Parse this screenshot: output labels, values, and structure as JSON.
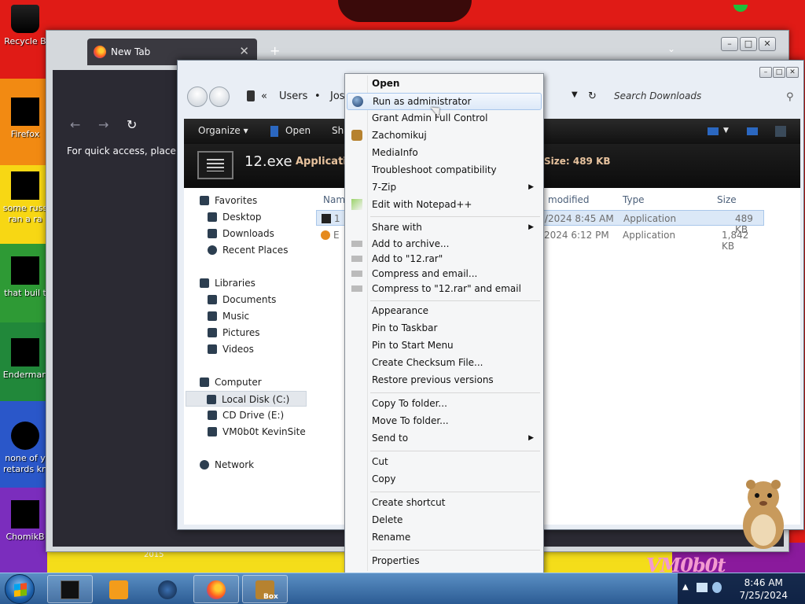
{
  "desktop": {
    "icons": [
      {
        "label": "Recycle B"
      },
      {
        "label": "Firefox"
      },
      {
        "label": "some russ"
      },
      {
        "label": "ran a ra"
      },
      {
        "label": "that buil t"
      },
      {
        "label": "Enderman"
      },
      {
        "label": "none of y"
      },
      {
        "label": "retards kn"
      },
      {
        "label": "ChomikB"
      }
    ],
    "wallpaper_text": "VM0b0t",
    "wallpaper_year": "2015"
  },
  "browser": {
    "tab_title": "New Tab",
    "new_tab_symbol": "+",
    "quick_access_text": "For quick access, place your"
  },
  "explorer": {
    "breadcrumb": [
      "«",
      "Users",
      "•",
      "Jos"
    ],
    "search_placeholder": "Search Downloads",
    "toolbar": {
      "organize": "Organize ▾",
      "open": "Open",
      "share": "Sha"
    },
    "details": {
      "name": "12.exe",
      "type": "Application",
      "size": "Size: 489 KB"
    },
    "nav": {
      "favorites": "Favorites",
      "desktop": "Desktop",
      "downloads": "Downloads",
      "recent": "Recent Places",
      "libraries": "Libraries",
      "documents": "Documents",
      "music": "Music",
      "pictures": "Pictures",
      "videos": "Videos",
      "computer": "Computer",
      "local_disk": "Local Disk (C:)",
      "cd_drive": "CD Drive (E:)",
      "vm": "VM0b0t KevinSite",
      "network": "Network"
    },
    "columns": {
      "name": "Name",
      "modified": "modified",
      "type": "Type",
      "size": "Size"
    },
    "files": [
      {
        "name": "1",
        "modified": "/2024 8:45 AM",
        "type": "Application",
        "size": "489 KB"
      },
      {
        "name": "E",
        "modified": "2024 6:12 PM",
        "type": "Application",
        "size": "1,842 KB"
      }
    ]
  },
  "context_menu": {
    "items": [
      {
        "label": "Open"
      },
      {
        "label": "Run as administrator"
      },
      {
        "label": "Grant Admin Full Control"
      },
      {
        "label": "Zachomikuj"
      },
      {
        "label": "MediaInfo"
      },
      {
        "label": "Troubleshoot compatibility"
      },
      {
        "label": "7-Zip"
      },
      {
        "label": "Edit with Notepad++"
      },
      {
        "label": "Share with"
      },
      {
        "label": "Add to archive..."
      },
      {
        "label": "Add to \"12.rar\""
      },
      {
        "label": "Compress and email..."
      },
      {
        "label": "Compress to \"12.rar\" and email"
      },
      {
        "label": "Appearance"
      },
      {
        "label": "Pin to Taskbar"
      },
      {
        "label": "Pin to Start Menu"
      },
      {
        "label": "Create Checksum File..."
      },
      {
        "label": "Restore previous versions"
      },
      {
        "label": "Copy To folder..."
      },
      {
        "label": "Move To folder..."
      },
      {
        "label": "Send to"
      },
      {
        "label": "Cut"
      },
      {
        "label": "Copy"
      },
      {
        "label": "Create shortcut"
      },
      {
        "label": "Delete"
      },
      {
        "label": "Rename"
      },
      {
        "label": "Properties"
      }
    ]
  },
  "taskbar": {
    "time": "8:46 AM",
    "date": "7/25/2024",
    "box_label": "Box"
  }
}
